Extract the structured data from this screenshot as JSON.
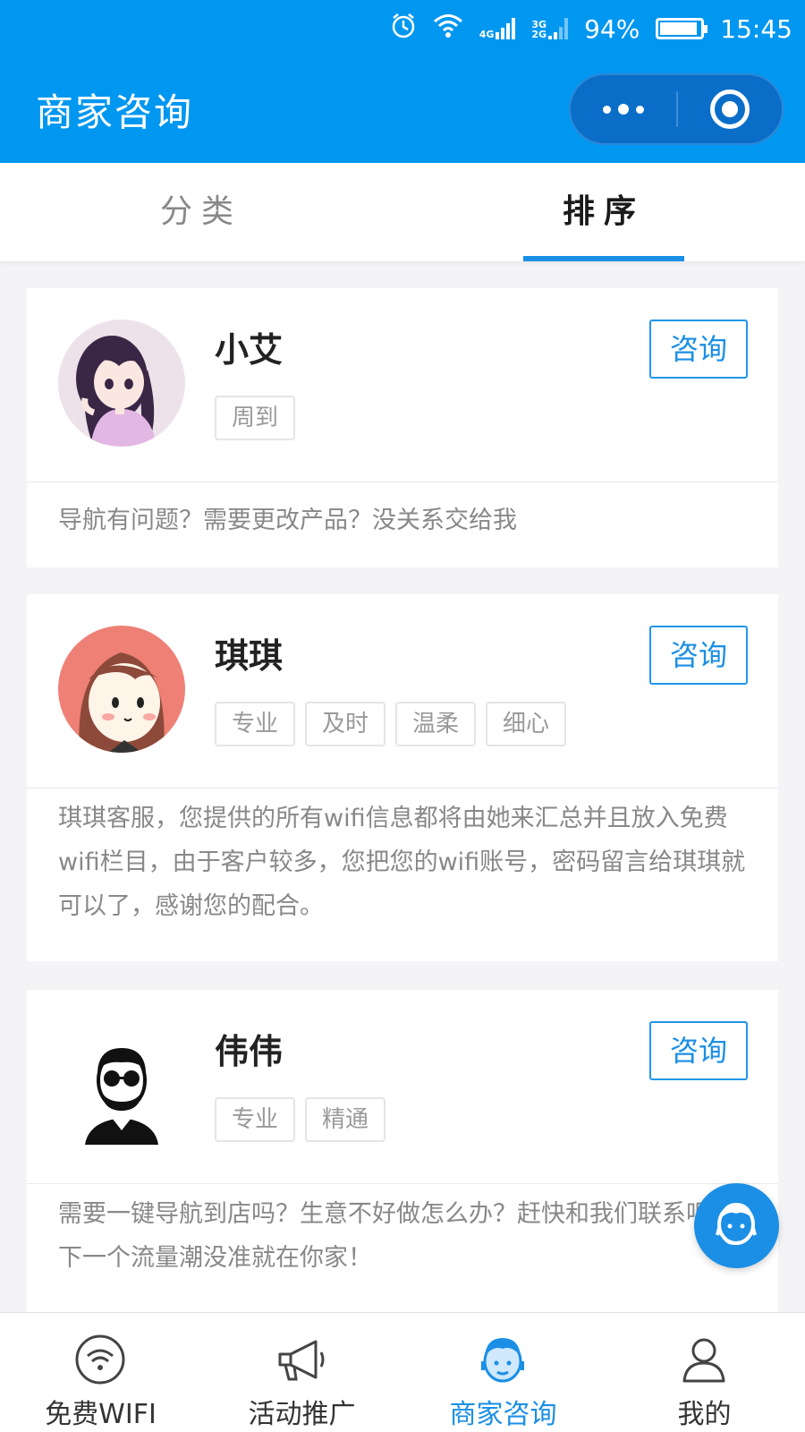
{
  "status_bar": {
    "time": "15:45",
    "battery": "94%",
    "battery_level": 0.94,
    "net1": "4G",
    "net2a": "3G",
    "net2b": "2G",
    "icons": [
      "alarm-icon",
      "wifi-icon",
      "signal-icon",
      "signal-icon",
      "battery-icon"
    ]
  },
  "nav": {
    "title": "商家咨询"
  },
  "tabs": [
    {
      "label": "分类",
      "active": false
    },
    {
      "label": "排序",
      "active": true
    }
  ],
  "consultants": [
    {
      "name": "小艾",
      "tags": [
        "周到"
      ],
      "button": "咨询",
      "description": "导航有问题？需要更改产品？没关系交给我"
    },
    {
      "name": "琪琪",
      "tags": [
        "专业",
        "及时",
        "温柔",
        "细心"
      ],
      "button": "咨询",
      "description": "琪琪客服，您提供的所有wifi信息都将由她来汇总并且放入免费wifi栏目，由于客户较多，您把您的wifi账号，密码留言给琪琪就可以了，感谢您的配合。"
    },
    {
      "name": "伟伟",
      "tags": [
        "专业",
        "精通"
      ],
      "button": "咨询",
      "description": "需要一键导航到店吗？生意不好做怎么办？赶快和我们联系吧，下一个流量潮没准就在你家！"
    }
  ],
  "bottom_nav": [
    {
      "label": "免费WIFI",
      "icon": "wifi-icon",
      "active": false
    },
    {
      "label": "活动推广",
      "icon": "megaphone-icon",
      "active": false
    },
    {
      "label": "商家咨询",
      "icon": "customer-service-icon",
      "active": true
    },
    {
      "label": "我的",
      "icon": "user-icon",
      "active": false
    }
  ],
  "colors": {
    "primary": "#0097f0",
    "accent": "#1b8fe5",
    "background": "#f4f4f6"
  }
}
